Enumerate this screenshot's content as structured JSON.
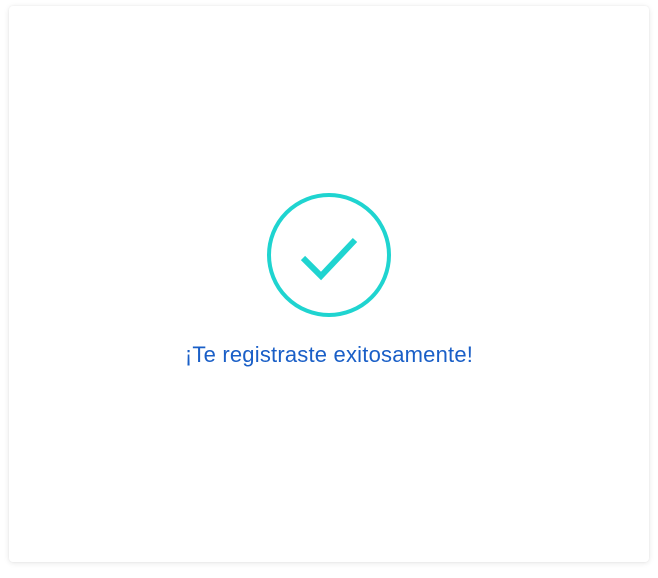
{
  "dialog": {
    "icon": "check-circle-icon",
    "icon_color": "#1fd4d0",
    "message": "¡Te registraste exitosamente!",
    "message_color": "#1a5fc7"
  }
}
